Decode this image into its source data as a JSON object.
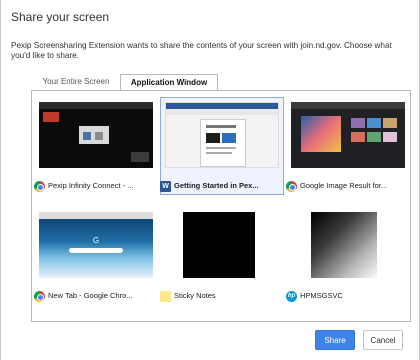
{
  "dialog": {
    "title": "Share your screen",
    "description": "Pexip Screensharing Extension wants to share the contents of your screen with join.nd.gov. Choose what you'd like to share."
  },
  "tabs": [
    {
      "label": "Your Entire Screen",
      "selected": false
    },
    {
      "label": "Application Window",
      "selected": true
    }
  ],
  "windows": [
    {
      "label": "Pexip Infinity Connect - ...",
      "icon": "chrome-icon",
      "selected": false
    },
    {
      "label": "Getting Started in Pex...",
      "icon": "word-icon",
      "selected": true
    },
    {
      "label": "Google Image Result for...",
      "icon": "chrome-icon",
      "selected": false
    },
    {
      "label": "New Tab - Google Chro...",
      "icon": "chrome-icon",
      "selected": false
    },
    {
      "label": "Sticky Notes",
      "icon": "sticky-notes-icon",
      "selected": false
    },
    {
      "label": "HPMSGSVC",
      "icon": "hp-icon",
      "selected": false
    }
  ],
  "buttons": {
    "share": "Share",
    "cancel": "Cancel"
  },
  "colors": {
    "accent": "#3f82e8",
    "selection": "#8ea9e0"
  }
}
